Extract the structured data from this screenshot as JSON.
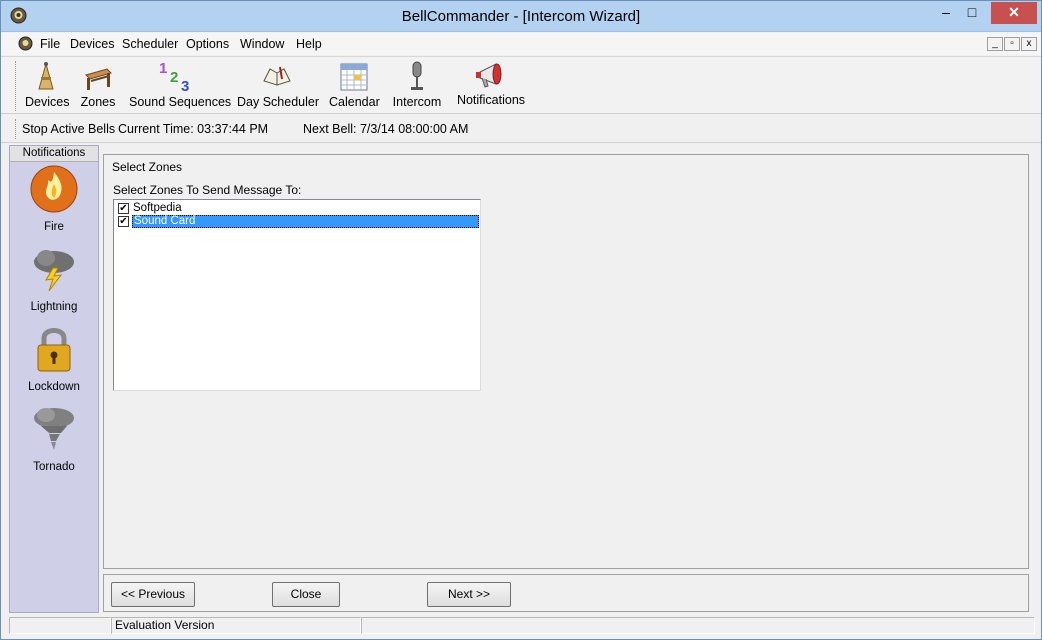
{
  "window": {
    "title": "BellCommander - [Intercom Wizard]",
    "controls": {
      "minimize": "–",
      "maximize": "□",
      "close": "✕"
    }
  },
  "menu": {
    "items": [
      "File",
      "Devices",
      "Scheduler",
      "Options",
      "Window",
      "Help"
    ],
    "mdi_controls": [
      "_",
      "▫",
      "x"
    ]
  },
  "toolbar": {
    "items": [
      {
        "label": "Devices",
        "icon": "devices-icon"
      },
      {
        "label": "Zones",
        "icon": "zones-icon"
      },
      {
        "label": "Sound Sequences",
        "icon": "sound-sequences-icon"
      },
      {
        "label": "Day Scheduler",
        "icon": "day-scheduler-icon"
      },
      {
        "label": "Calendar",
        "icon": "calendar-icon"
      },
      {
        "label": "Intercom",
        "icon": "microphone-icon"
      },
      {
        "label": "Notifications",
        "icon": "megaphone-icon"
      }
    ]
  },
  "status": {
    "stop_bells": "Stop Active Bells",
    "current_time": "Current Time: 03:37:44 PM",
    "next_bell": "Next Bell: 7/3/14 08:00:00 AM"
  },
  "side_panel": {
    "header": "Notifications",
    "items": [
      {
        "label": "Fire",
        "icon": "fire-icon"
      },
      {
        "label": "Lightning",
        "icon": "lightning-icon"
      },
      {
        "label": "Lockdown",
        "icon": "lock-icon"
      },
      {
        "label": "Tornado",
        "icon": "tornado-icon"
      }
    ]
  },
  "wizard": {
    "group_title": "Select Zones",
    "list_label": "Select Zones To Send Message To:",
    "zones": [
      {
        "name": "Softpedia",
        "checked": true,
        "selected": false
      },
      {
        "name": "Sound Card",
        "checked": true,
        "selected": true
      }
    ],
    "buttons": {
      "previous": "<< Previous",
      "close": "Close",
      "next": "Next >>"
    }
  },
  "footer": {
    "cells": [
      "",
      "Evaluation Version",
      ""
    ]
  },
  "colors": {
    "titlebar": "#b3d1f0",
    "close_button": "#c75050",
    "selection": "#3399ff",
    "side_panel": "#cfd0e8"
  }
}
